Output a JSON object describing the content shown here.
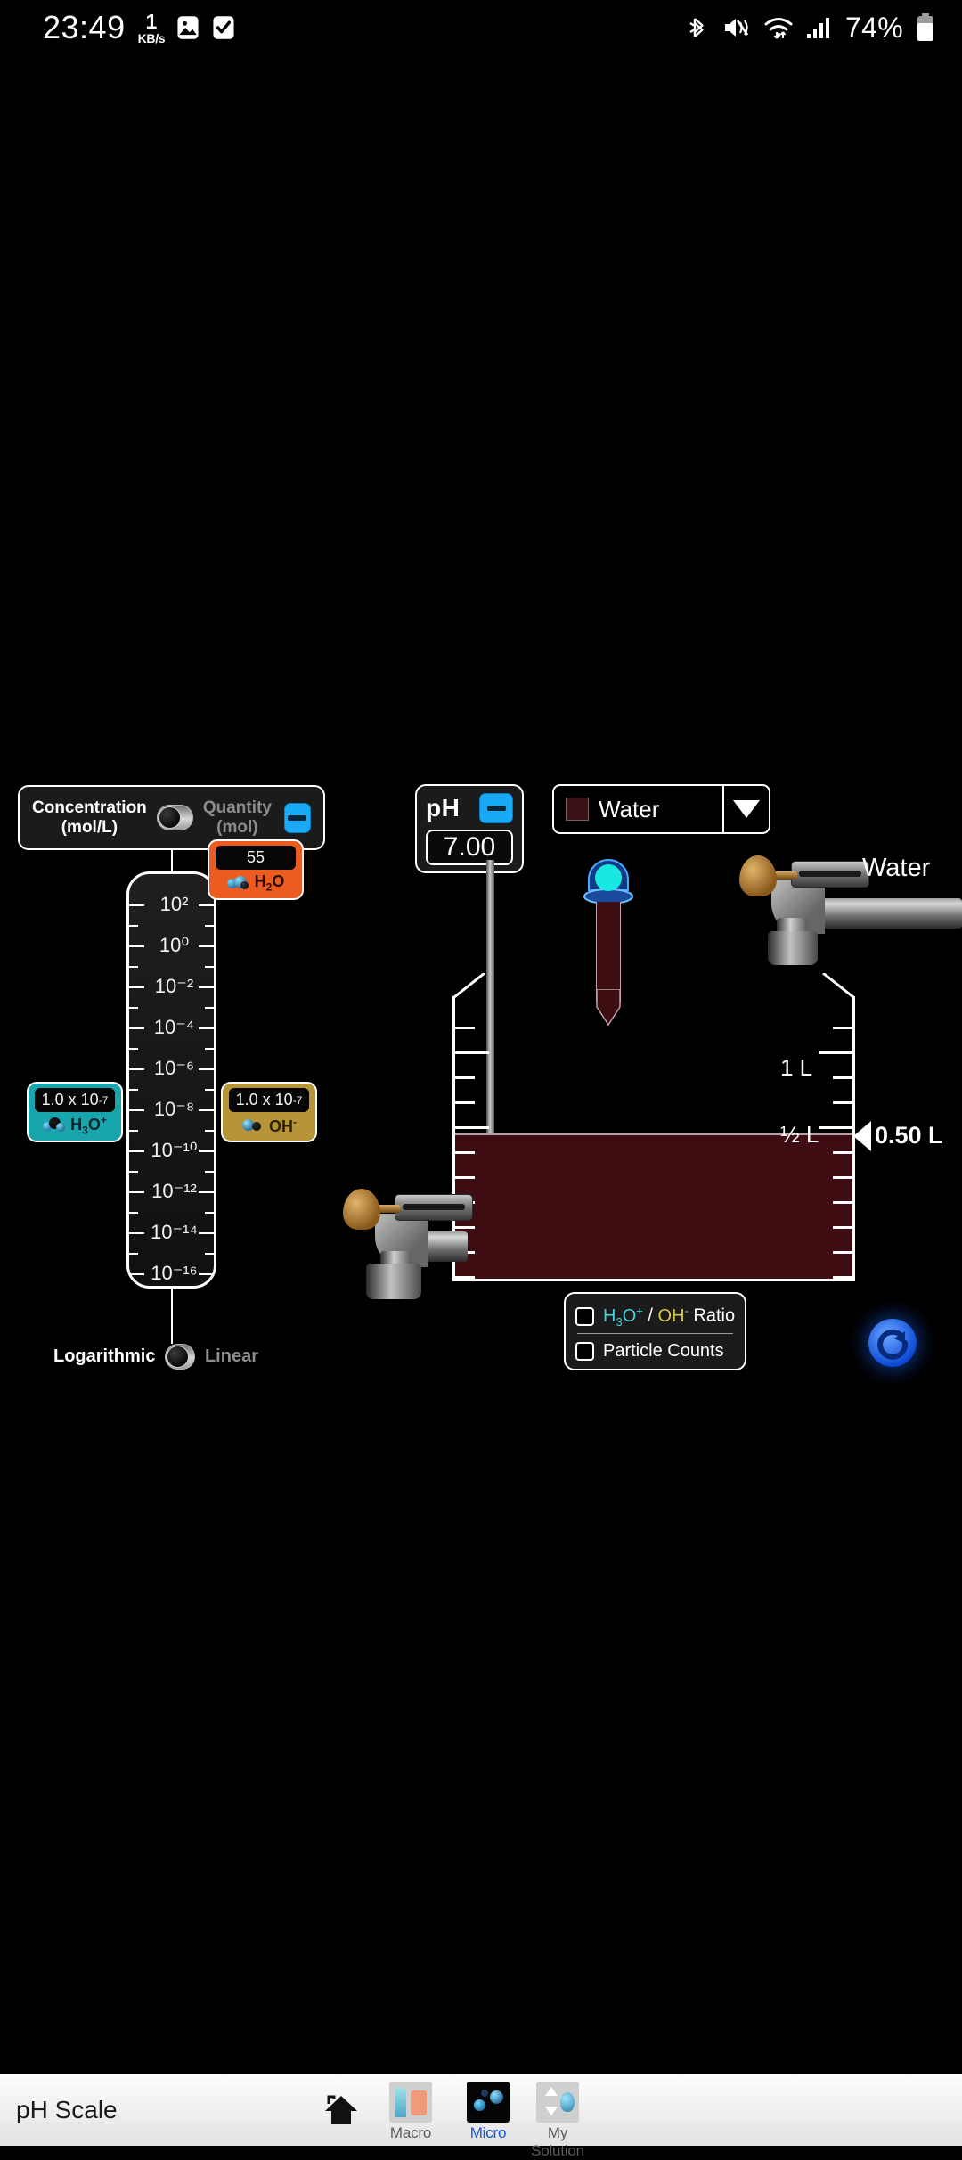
{
  "status_bar": {
    "time": "23:49",
    "net_speed_value": "1",
    "net_speed_unit": "KB/s",
    "icons_left": [
      "image-icon",
      "checkbox-icon"
    ],
    "icons_right": [
      "bluetooth-icon",
      "mute-icon",
      "wifi-icon",
      "signal-icon"
    ],
    "battery_percent": "74%"
  },
  "concentration_panel": {
    "left_label_line1": "Concentration",
    "left_label_line2": "(mol/L)",
    "right_label_line1": "Quantity",
    "right_label_line2": "(mol)",
    "toggle_position": "left",
    "collapse_button": "minus-icon"
  },
  "graph": {
    "tick_labels": [
      "10²",
      "10⁰",
      "10⁻²",
      "10⁻⁴",
      "10⁻⁶",
      "10⁻⁸",
      "10⁻¹⁰",
      "10⁻¹²",
      "10⁻¹⁴",
      "10⁻¹⁶"
    ],
    "exponents": [
      2,
      0,
      -2,
      -4,
      -6,
      -8,
      -10,
      -12,
      -14,
      -16
    ],
    "scale_toggle": {
      "left_label": "Logarithmic",
      "right_label": "Linear",
      "active": "Logarithmic"
    }
  },
  "callouts": {
    "h2o": {
      "value": "55",
      "species_base": "H",
      "species_sub": "2",
      "species_tail": "O",
      "color": "#ec5c21"
    },
    "h3o": {
      "value_mantissa": "1.0 x 10",
      "value_exponent": "-7",
      "species_base": "H",
      "species_sub": "3",
      "species_tail": "O",
      "species_sup": "+",
      "color": "#18a5ae"
    },
    "oh": {
      "value_mantissa": "1.0 x 10",
      "value_exponent": "-7",
      "species_base": "OH",
      "species_sup": "-",
      "color": "#b79438"
    }
  },
  "ph_meter": {
    "label": "pH",
    "value": "7.00",
    "collapse_button": "minus-icon"
  },
  "solution": {
    "name": "Water",
    "swatch_color": "#3b1216",
    "dropdown_icon": "chevron-down-icon"
  },
  "beaker": {
    "volume_labels": [
      {
        "text": "1 L"
      },
      {
        "text": "½ L"
      }
    ],
    "level_readout": "0.50 L",
    "water_color": "#3d0d12"
  },
  "faucets": {
    "water_label": "Water"
  },
  "options": {
    "ratio": {
      "h3o_base": "H",
      "h3o_sub": "3",
      "h3o_tail": "O",
      "h3o_sup": "+",
      "sep": " / ",
      "oh_base": "OH",
      "oh_sup": "-",
      "tail": " Ratio",
      "checked": false
    },
    "particle_counts": {
      "label": "Particle Counts",
      "checked": false
    }
  },
  "reset_button": {
    "icon": "refresh-icon"
  },
  "nav": {
    "title": "pH Scale",
    "home_icon": "home-icon",
    "tabs": [
      {
        "label": "Macro",
        "active": false
      },
      {
        "label": "Micro",
        "active": true
      },
      {
        "label": "My Solution",
        "active": false
      }
    ]
  }
}
